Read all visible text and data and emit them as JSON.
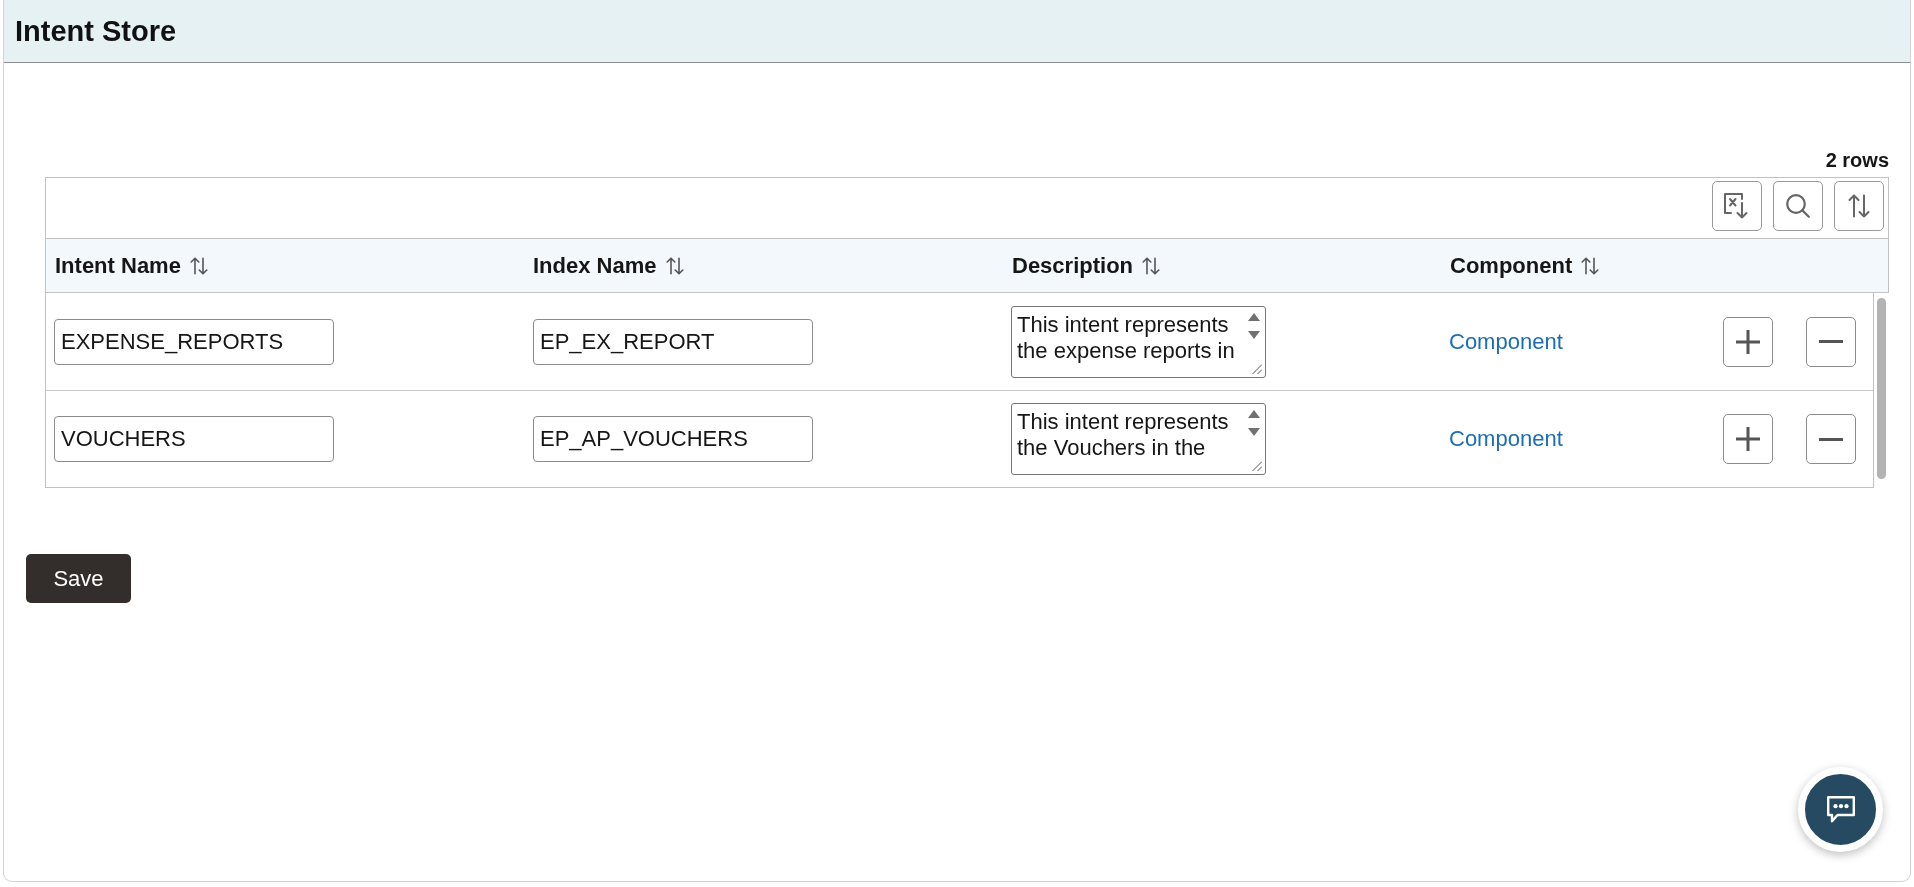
{
  "header": {
    "title": "Intent Store"
  },
  "grid": {
    "row_count": "2 rows",
    "columns": [
      "Intent Name",
      "Index Name",
      "Description",
      "Component"
    ],
    "rows": [
      {
        "intent_name": "EXPENSE_REPORTS",
        "index_name": "EP_EX_REPORT",
        "description": "This intent represents the expense reports in",
        "component": "Component"
      },
      {
        "intent_name": "VOUCHERS",
        "index_name": "EP_AP_VOUCHERS",
        "description": "This intent represents the Vouchers in the",
        "component": "Component"
      }
    ]
  },
  "actions": {
    "save_button": "Save"
  }
}
